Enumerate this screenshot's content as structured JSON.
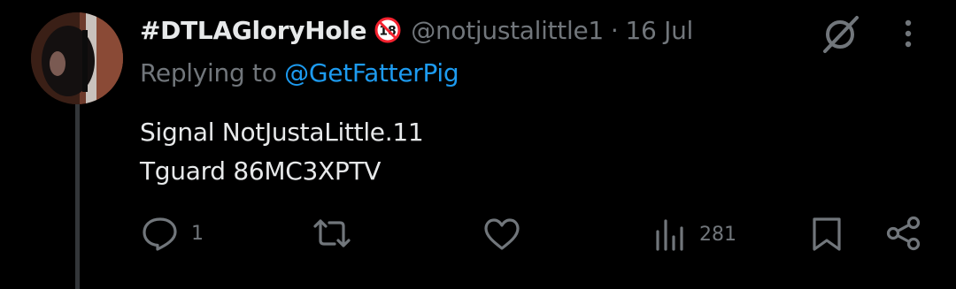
{
  "tweet": {
    "display_name": "#DTLAGloryHole",
    "age_badge": "18",
    "handle": "@notjustalittle1",
    "separator": "·",
    "date": "16 Jul",
    "replying_prefix": "Replying to",
    "replying_handle": "@GetFatterPig",
    "body_lines": [
      "Signal NotJustaLittle.11",
      "Tguard 86MC3XPTV"
    ]
  },
  "actions": {
    "reply_count": "1",
    "retweet_count": "",
    "like_count": "",
    "views_count": "281"
  },
  "colors": {
    "background": "#000000",
    "text_primary": "#e7e9ea",
    "text_secondary": "#71767b",
    "link": "#1d9bf0",
    "badge_red": "#f4212e"
  },
  "icons": {
    "grok": "grok-icon",
    "more": "more-vertical-icon",
    "reply": "reply-icon",
    "retweet": "retweet-icon",
    "like": "heart-icon",
    "views": "views-icon",
    "bookmark": "bookmark-icon",
    "share": "share-icon"
  }
}
